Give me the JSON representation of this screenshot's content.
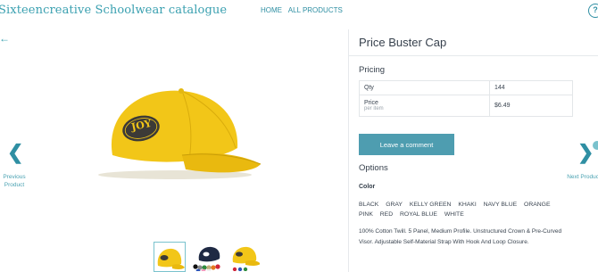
{
  "header": {
    "brand": "Sixteencreative Schoolwear catalogue",
    "nav": [
      "HOME",
      "ALL PRODUCTS"
    ],
    "help_icon": "?"
  },
  "gallery": {
    "back_icon": "arrow-left-icon",
    "previous_label": "Previous Product",
    "next_label": "Next Product",
    "cap_logo_text": "JOY",
    "thumbnails": [
      "yellow-cap",
      "color-range",
      "yellow-cap-variant"
    ]
  },
  "product": {
    "title": "Price Buster Cap",
    "pricing_heading": "Pricing",
    "qty_label": "Qty",
    "qty_value": "144",
    "price_label": "Price",
    "price_unit": "per item",
    "price_value": "$6.49",
    "comment_button": "Leave a comment",
    "options_heading": "Options",
    "color_heading": "Color",
    "colors": [
      "BLACK",
      "GRAY",
      "KELLY GREEN",
      "KHAKI",
      "NAVY BLUE",
      "ORANGE",
      "PINK",
      "RED",
      "ROYAL BLUE",
      "WHITE"
    ],
    "description": "100% Cotton Twill. 5 Panel, Medium Profile. Unstructured Crown & Pre-Curved Visor. Adjustable Self-Material Strap With Hook And Loop Closure."
  },
  "colors": {
    "accent": "#4e9db0",
    "cap_yellow": "#f2c618",
    "cap_patch": "#3c3a37"
  }
}
